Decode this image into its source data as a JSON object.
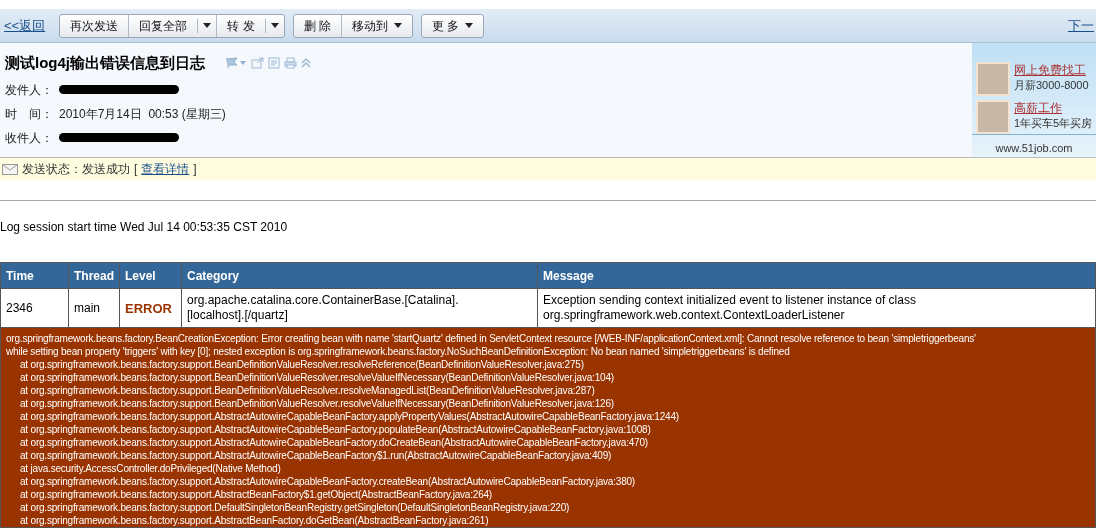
{
  "toolbar": {
    "back_link": "<<返回",
    "groups": [
      {
        "buttons": [
          {
            "label": "再次发送",
            "kind": "plain"
          },
          {
            "label": "回复全部",
            "kind": "split"
          },
          {
            "label": "转 发",
            "kind": "split"
          }
        ]
      },
      {
        "buttons": [
          {
            "label": "删 除",
            "kind": "plain"
          },
          {
            "label": "移动到",
            "kind": "menu"
          }
        ]
      },
      {
        "buttons": [
          {
            "label": "更 多",
            "kind": "menu"
          }
        ]
      }
    ],
    "next_link": "下一"
  },
  "header": {
    "subject": "测试log4j输出错误信息到日志",
    "fields": [
      {
        "label": "发件人：",
        "kind": "redacted"
      },
      {
        "label": "时　间：",
        "kind": "text",
        "value": "2010年7月14日  00:53 (星期三)"
      },
      {
        "label": "收件人：",
        "kind": "redacted"
      }
    ]
  },
  "ad": {
    "items": [
      {
        "title": "网上免费找工",
        "subtitle": "月薪3000-8000"
      },
      {
        "title": "高薪工作",
        "subtitle": "1年买车5年买房"
      }
    ],
    "footer": "www.51job.com"
  },
  "status": {
    "label": "发送状态：发送成功",
    "bracket_open": "[",
    "link": "查看详情",
    "bracket_close": "]"
  },
  "log": {
    "session_line": "Log session start time Wed Jul 14 00:53:35 CST 2010",
    "table": {
      "columns": [
        "Time",
        "Thread",
        "Level",
        "Category",
        "Message"
      ],
      "rows": [
        {
          "cells": [
            "2346",
            "main",
            "ERROR",
            "org.apache.catalina.core.ContainerBase.[Catalina].\n[localhost].[/quartz]",
            "Exception sending context initialized event to listener instance of class\norg.springframework.web.context.ContextLoaderListener"
          ]
        }
      ],
      "stack_trace": [
        {
          "kind": "message",
          "text": "org.springframework.beans.factory.BeanCreationException: Error creating bean with name 'startQuartz' defined in ServletContext resource [/WEB-INF/applicationContext.xml]: Cannot resolve reference to bean 'simpletriggerbeans'"
        },
        {
          "kind": "message",
          "text": "while setting bean property 'triggers' with key [0]; nested exception is org.springframework.beans.factory.NoSuchBeanDefinitionException: No bean named 'simpletriggerbeans' is defined"
        },
        {
          "kind": "frame",
          "text": "at org.springframework.beans.factory.support.BeanDefinitionValueResolver.resolveReference(BeanDefinitionValueResolver.java:275)"
        },
        {
          "kind": "frame",
          "text": "at org.springframework.beans.factory.support.BeanDefinitionValueResolver.resolveValueIfNecessary(BeanDefinitionValueResolver.java:104)"
        },
        {
          "kind": "frame",
          "text": "at org.springframework.beans.factory.support.BeanDefinitionValueResolver.resolveManagedList(BeanDefinitionValueResolver.java:287)"
        },
        {
          "kind": "frame",
          "text": "at org.springframework.beans.factory.support.BeanDefinitionValueResolver.resolveValueIfNecessary(BeanDefinitionValueResolver.java:126)"
        },
        {
          "kind": "frame",
          "text": "at org.springframework.beans.factory.support.AbstractAutowireCapableBeanFactory.applyPropertyValues(AbstractAutowireCapableBeanFactory.java:1244)"
        },
        {
          "kind": "frame",
          "text": "at org.springframework.beans.factory.support.AbstractAutowireCapableBeanFactory.populateBean(AbstractAutowireCapableBeanFactory.java:1008)"
        },
        {
          "kind": "frame",
          "text": "at org.springframework.beans.factory.support.AbstractAutowireCapableBeanFactory.doCreateBean(AbstractAutowireCapableBeanFactory.java:470)"
        },
        {
          "kind": "frame",
          "text": "at org.springframework.beans.factory.support.AbstractAutowireCapableBeanFactory$1.run(AbstractAutowireCapableBeanFactory.java:409)"
        },
        {
          "kind": "frame",
          "text": "at java.security.AccessController.doPrivileged(Native Method)"
        },
        {
          "kind": "frame",
          "text": "at org.springframework.beans.factory.support.AbstractAutowireCapableBeanFactory.createBean(AbstractAutowireCapableBeanFactory.java:380)"
        },
        {
          "kind": "frame",
          "text": "at org.springframework.beans.factory.support.AbstractBeanFactory$1.getObject(AbstractBeanFactory.java:264)"
        },
        {
          "kind": "frame",
          "text": "at org.springframework.beans.factory.support.DefaultSingletonBeanRegistry.getSingleton(DefaultSingletonBeanRegistry.java:220)"
        },
        {
          "kind": "frame",
          "text": "at org.springframework.beans.factory.support.AbstractBeanFactory.doGetBean(AbstractBeanFactory.java:261)"
        }
      ]
    }
  }
}
